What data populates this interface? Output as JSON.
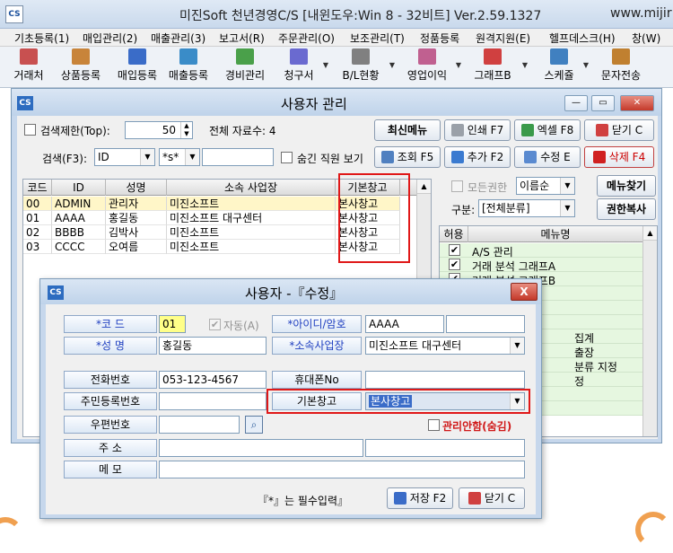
{
  "app": {
    "title": "미진Soft 천년경영C/S [내윈도우:Win 8 - 32비트] Ver.2.59.1327",
    "url_fragment": "www.mijir",
    "logo_text": "CS"
  },
  "menubar": [
    "기초등록(1)",
    "매입관리(2)",
    "매출관리(3)",
    "보고서(R)",
    "주문관리(O)",
    "보조관리(T)",
    "정품등록",
    "원격지원(E)",
    "헬프데스크(H)",
    "창(W)"
  ],
  "toolbar": [
    {
      "label": "거래처",
      "icon": "person-card-icon",
      "color": "#c85050"
    },
    {
      "label": "상품등록",
      "icon": "box-icon",
      "color": "#c8843a"
    },
    {
      "label": "매입등록",
      "icon": "purchase-icon",
      "color": "#3a6cc8"
    },
    {
      "label": "매출등록",
      "icon": "sales-icon",
      "color": "#3a8cc8"
    },
    {
      "label": "경비관리",
      "icon": "expense-icon",
      "color": "#4aa04a"
    },
    {
      "label": "청구서",
      "icon": "invoice-icon",
      "color": "#6a6ad0"
    },
    {
      "label": "B/L현황",
      "icon": "calendar-icon",
      "color": "#808080"
    },
    {
      "label": "영업이익",
      "icon": "profit-icon",
      "color": "#c06090"
    },
    {
      "label": "그래프B",
      "icon": "bar-chart-icon",
      "color": "#d04040"
    },
    {
      "label": "스케쥴",
      "icon": "schedule-icon",
      "color": "#4080c0"
    },
    {
      "label": "문자전송",
      "icon": "sms-icon",
      "color": "#c08030"
    }
  ],
  "user_window": {
    "title": "사용자 관리",
    "logo_text": "CS",
    "search_limit_label": "검색제한(Top):",
    "search_limit_value": "50",
    "total_label": "전체 자료수: 4",
    "btn_refresh": "최신메뉴",
    "btn_print": "인쇄 F7",
    "btn_excel": "엑셀 F8",
    "btn_close": "닫기 C",
    "search_label": "검색(F3):",
    "search_field": "ID",
    "search_op": "*s*",
    "search_value": "",
    "hidden_label": "숨긴 직원 보기",
    "btn_search": "조회 F5",
    "btn_add": "추가 F2",
    "btn_edit": "수정 E",
    "btn_delete": "삭제 F4",
    "columns": [
      "코드",
      "ID",
      "성명",
      "소속 사업장",
      "기본창고"
    ],
    "rows": [
      [
        "00",
        "ADMIN",
        "관리자",
        "미진소프트",
        "본사창고"
      ],
      [
        "01",
        "AAAA",
        "홍길동",
        "미진소프트 대구센터",
        "본사창고"
      ],
      [
        "02",
        "BBBB",
        "김박사",
        "미진소프트",
        "본사창고"
      ],
      [
        "03",
        "CCCC",
        "오여름",
        "미진소프트",
        "본사창고"
      ]
    ],
    "perm_all_label": "모든권한",
    "perm_sort": "이름순",
    "btn_find_menu": "메뉴찾기",
    "category_label": "구분:",
    "category_value": "[전체분류]",
    "btn_copy_perm": "권한복사",
    "menu_columns": [
      "허용",
      "메뉴명"
    ],
    "menu_rows": [
      {
        "checked": "✔",
        "name": "A/S 관리"
      },
      {
        "checked": "✔",
        "name": "거래 분석 그래프A"
      },
      {
        "checked": "✔",
        "name": "거래 분석 그래프B"
      }
    ],
    "menu_fragments": [
      "집계",
      "출장",
      "분류 지정",
      "정"
    ]
  },
  "dialog": {
    "title": "사용자 -『수정』",
    "logo_text": "CS",
    "close_label": "X",
    "code_label": "*코  드",
    "code_value": "01",
    "auto_label": "자동(A)",
    "id_label": "*아이디/암호",
    "id_value": "AAAA",
    "pw_value": "",
    "name_label": "*성  명",
    "name_value": "홍길동",
    "branch_label": "*소속사업장",
    "branch_value": "미진소프트 대구센터",
    "phone_label": "전화번호",
    "phone_value": "053-123-4567",
    "mobile_label": "휴대폰No",
    "mobile_value": "",
    "ssn_label": "주민등록번호",
    "ssn_value": "",
    "warehouse_label": "기본창고",
    "warehouse_value": "본사창고",
    "zip_label": "우편번호",
    "zip_value": "",
    "hidden_label": "관리안함(숨김)",
    "addr_label": "주  소",
    "addr_value": "",
    "memo_label": "메  모",
    "memo_value": "",
    "required_note": "『*』는 필수입력』",
    "btn_save": "저장 F2",
    "btn_close": "닫기 C"
  }
}
